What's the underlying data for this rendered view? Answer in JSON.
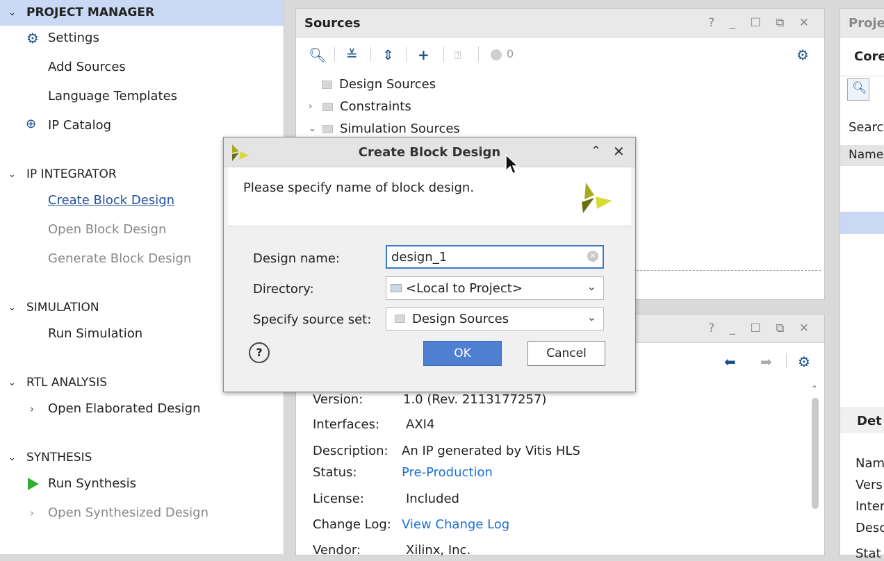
{
  "flow_navigator": {
    "sections": [
      {
        "title": "PROJECT MANAGER",
        "items": [
          {
            "label": "Settings"
          },
          {
            "label": "Add Sources"
          },
          {
            "label": "Language Templates"
          },
          {
            "label": "IP Catalog"
          }
        ]
      },
      {
        "title": "IP INTEGRATOR",
        "items": [
          {
            "label": "Create Block Design"
          },
          {
            "label": "Open Block Design"
          },
          {
            "label": "Generate Block Design"
          }
        ]
      },
      {
        "title": "SIMULATION",
        "items": [
          {
            "label": "Run Simulation"
          }
        ]
      },
      {
        "title": "RTL ANALYSIS",
        "items": [
          {
            "label": "Open Elaborated Design"
          }
        ]
      },
      {
        "title": "SYNTHESIS",
        "items": [
          {
            "label": "Run Synthesis"
          },
          {
            "label": "Open Synthesized Design"
          }
        ]
      }
    ]
  },
  "sources_panel": {
    "title": "Sources",
    "window_controls": "? _ ☐ ⧉ ✕",
    "toolbar_badge": "0",
    "tree": [
      {
        "label": "Design Sources"
      },
      {
        "label": "Constraints"
      },
      {
        "label": "Simulation Sources"
      }
    ]
  },
  "ip_details_panel": {
    "window_controls": "? _ ☐ ⧉ ✕",
    "rows": [
      {
        "key": "Version:",
        "value": "1.0 (Rev. 2113177257)"
      },
      {
        "key": "Interfaces:",
        "value": "AXI4"
      },
      {
        "key": "Description:",
        "value": "An IP generated by Vitis HLS"
      },
      {
        "key": "Status:",
        "value": "Pre-Production"
      },
      {
        "key": "License:",
        "value": "Included"
      },
      {
        "key": "Change Log:",
        "value": "View Change Log"
      },
      {
        "key": "Vendor:",
        "value": "Xilinx, Inc."
      }
    ]
  },
  "right_panel": {
    "title_fragment": "Proje",
    "tab_fragment": "Core",
    "search_fragment": "Searc",
    "column_fragment": "Name",
    "details_fragment": "Det",
    "detail_keys": [
      "Nam",
      "Vers",
      "Inter",
      "Desc",
      "Stat"
    ]
  },
  "dialog": {
    "title": "Create Block Design",
    "prompt": "Please specify name of block design.",
    "design_name_label": "Design name:",
    "design_name_value": "design_1",
    "directory_label": "Directory:",
    "directory_value": "<Local to Project>",
    "source_set_label": "Specify source set:",
    "source_set_value": "Design Sources",
    "ok_label": "OK",
    "cancel_label": "Cancel",
    "help_glyph": "?"
  },
  "colors": {
    "accent": "#4f7fd0",
    "link": "#1a6ed8",
    "run_green": "#2fb12f",
    "selection": "#c9d9f4"
  }
}
